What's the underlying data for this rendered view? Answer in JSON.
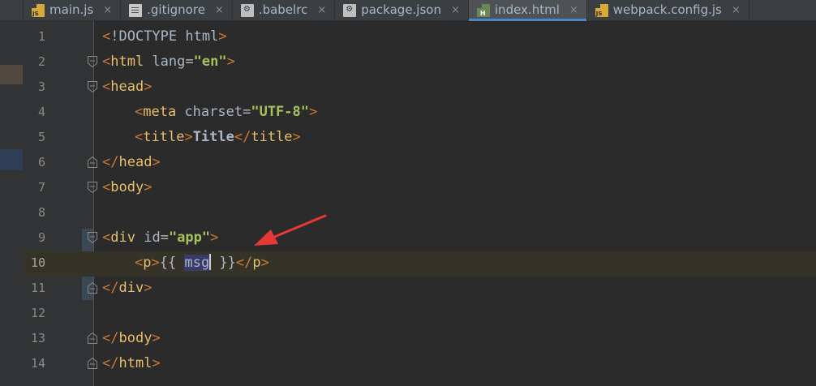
{
  "tabs": [
    {
      "label": "main.js",
      "icon": "js-file-icon",
      "active": false
    },
    {
      "label": ".gitignore",
      "icon": "text-file-icon",
      "active": false
    },
    {
      "label": ".babelrc",
      "icon": "config-file-icon",
      "active": false
    },
    {
      "label": "package.json",
      "icon": "json-file-icon",
      "active": false
    },
    {
      "label": "index.html",
      "icon": "html-file-icon",
      "active": true
    },
    {
      "label": "webpack.config.js",
      "icon": "js-file-icon",
      "active": false
    }
  ],
  "close_glyph": "×",
  "editor": {
    "current_line": 10,
    "selection_text": "msg",
    "lines": [
      {
        "n": "1",
        "text": "<!DOCTYPE html>"
      },
      {
        "n": "2",
        "text": "<html lang=\"en\">"
      },
      {
        "n": "3",
        "text": "<head>"
      },
      {
        "n": "4",
        "text": "<meta charset=\"UTF-8\">"
      },
      {
        "n": "5",
        "text": "<title>Title</title>"
      },
      {
        "n": "6",
        "text": "</head>"
      },
      {
        "n": "7",
        "text": "<body>"
      },
      {
        "n": "8",
        "text": ""
      },
      {
        "n": "9",
        "text": "<div id=\"app\">"
      },
      {
        "n": "10",
        "text": "<p>{{ msg }}</p>"
      },
      {
        "n": "11",
        "text": "</div>"
      },
      {
        "n": "12",
        "text": ""
      },
      {
        "n": "13",
        "text": "</body>"
      },
      {
        "n": "14",
        "text": "</html>"
      }
    ]
  },
  "colors": {
    "tag": "#cc7832",
    "tag_name": "#e8bf6a",
    "attr_value": "#a5c25c",
    "annotation_arrow": "#e53935",
    "active_tab_underline": "#4a88c7"
  }
}
